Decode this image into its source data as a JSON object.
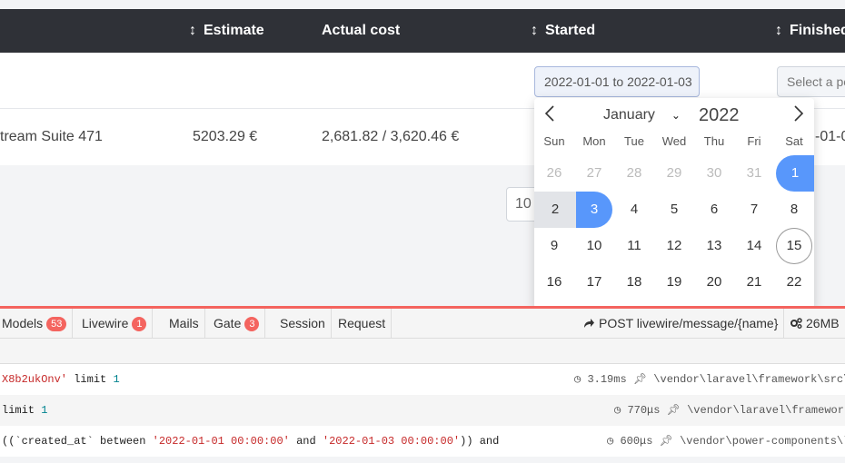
{
  "table": {
    "headers": {
      "estimate": "Estimate",
      "actual_cost": "Actual cost",
      "started": "Started",
      "finished": "Finished"
    },
    "sort_icon": "↕",
    "filters": {
      "started_value": "2022-01-01 to 2022-01-03",
      "finished_placeholder": "Select a period"
    },
    "row": {
      "name": "tream Suite 471",
      "estimate": "5203.29 €",
      "actual_cost": "2,681.82 / 3,620.46 €",
      "finished": "-01-0"
    },
    "per_page": "10"
  },
  "calendar": {
    "month": "January",
    "year": "2022",
    "prev_icon": "chevron-left",
    "next_icon": "chevron-right",
    "weekdays": [
      "Sun",
      "Mon",
      "Tue",
      "Wed",
      "Thu",
      "Fri",
      "Sat"
    ],
    "days": [
      [
        "26",
        "27",
        "28",
        "29",
        "30",
        "31",
        "1"
      ],
      [
        "2",
        "3",
        "4",
        "5",
        "6",
        "7",
        "8"
      ],
      [
        "9",
        "10",
        "11",
        "12",
        "13",
        "14",
        "15"
      ],
      [
        "16",
        "17",
        "18",
        "19",
        "20",
        "21",
        "22"
      ]
    ],
    "range_start": "1",
    "range_end": "3",
    "today": "15",
    "accent": "#5897fb"
  },
  "debugbar": {
    "tabs": [
      {
        "label": "Models",
        "badge": "53"
      },
      {
        "label": "Livewire",
        "badge": "1"
      },
      {
        "label": "Mails",
        "badge": null
      },
      {
        "label": "Gate",
        "badge": "3"
      },
      {
        "label": "Session",
        "badge": null
      },
      {
        "label": "Request",
        "badge": null
      }
    ],
    "request": "POST livewire/message/{name}",
    "memory": "26MB",
    "accent": "#f4645f",
    "queries": [
      {
        "sql_a": "X8b2ukOnv'",
        "sql_b": " limit ",
        "sql_c": "1",
        "time": "3.19ms",
        "path": "\\vendor\\laravel\\framework\\src\\I"
      },
      {
        "sql_a": "",
        "sql_b": "limit ",
        "sql_c": "1",
        "time": "770μs",
        "path": "\\vendor\\laravel\\framework\\"
      },
      {
        "sql_pre": "((`created_at` between ",
        "sql_d1": "'2022-01-01 00:00:00'",
        "sql_and": " and ",
        "sql_d2": "'2022-01-03 00:00:00'",
        "sql_post": ")) and",
        "time": "600μs",
        "path": "\\vendor\\power-components\\li"
      }
    ]
  }
}
